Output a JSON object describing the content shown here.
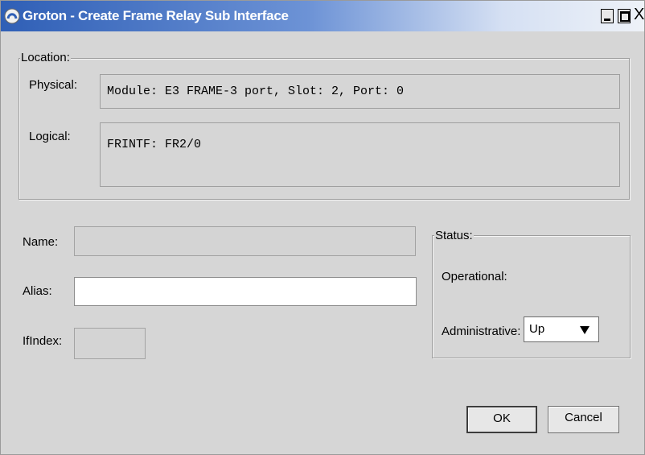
{
  "window": {
    "title": "Groton - Create Frame Relay Sub Interface",
    "controls": {
      "minimize": "_",
      "maximize": "□",
      "close": "X"
    }
  },
  "location": {
    "legend": "Location:",
    "physical_label": "Physical:",
    "physical_value": "Module: E3 FRAME-3 port, Slot: 2, Port: 0",
    "logical_label": "Logical:",
    "logical_value": "FRINTF: FR2/0"
  },
  "form": {
    "name_label": "Name:",
    "name_value": "",
    "alias_label": "Alias:",
    "alias_value": "",
    "ifindex_label": "IfIndex:",
    "ifindex_value": ""
  },
  "status": {
    "legend": "Status:",
    "operational_label": "Operational:",
    "administrative_label": "Administrative:",
    "administrative_value": "Up"
  },
  "buttons": {
    "ok": "OK",
    "cancel": "Cancel"
  }
}
